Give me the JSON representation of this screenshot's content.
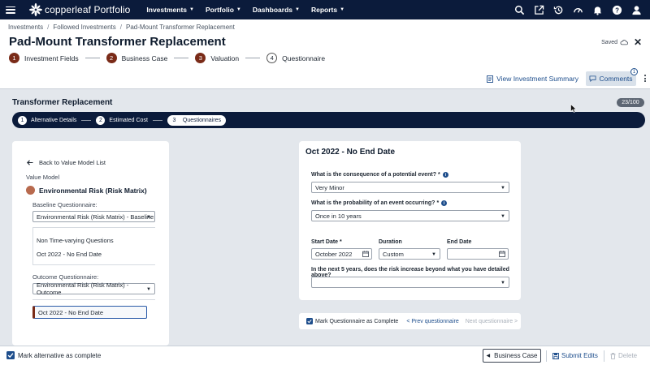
{
  "nav": {
    "logo_text": "copperleaf Portfolio",
    "menu": [
      {
        "label": "Investments"
      },
      {
        "label": "Portfolio"
      },
      {
        "label": "Dashboards"
      },
      {
        "label": "Reports"
      }
    ],
    "icons": [
      "search-icon",
      "external-link-icon",
      "history-icon",
      "performance-icon",
      "bell-icon",
      "help-icon",
      "user-icon"
    ]
  },
  "breadcrumb": [
    "Investments",
    "Followed Investments",
    "Pad-Mount Transformer Replacement"
  ],
  "page_title": "Pad-Mount Transformer Replacement",
  "saved_label": "Saved",
  "steps": [
    {
      "num": "1",
      "label": "Investment Fields"
    },
    {
      "num": "2",
      "label": "Business Case"
    },
    {
      "num": "3",
      "label": "Valuation"
    },
    {
      "num": "4",
      "label": "Questionnaire"
    }
  ],
  "view_summary_label": "View Investment Summary",
  "comments": {
    "label": "Comments",
    "count": "1"
  },
  "section": {
    "title": "Transformer Replacement",
    "counter": "23/100"
  },
  "substeps": [
    {
      "num": "1",
      "label": "Alternative Details"
    },
    {
      "num": "2",
      "label": "Estimated Cost"
    },
    {
      "num": "3",
      "label": "Questionnaires"
    }
  ],
  "left_panel": {
    "back_label": "Back to Value Model List",
    "value_model_label": "Value Model",
    "value_model_name": "Environmental Risk (Risk Matrix)",
    "baseline_label": "Baseline Questionnaire:",
    "baseline_value": "Environmental Risk (Risk Matrix) - Baseline",
    "baseline_items": [
      "Non Time-varying Questions",
      "Oct 2022 - No End Date"
    ],
    "outcome_label": "Outcome Questionnaire:",
    "outcome_value": "Environmental Risk (Risk Matrix) - Outcome",
    "outcome_selected": "Oct 2022 - No End Date"
  },
  "right_panel": {
    "title": "Oct 2022 - No End Date",
    "q1_label": "What is the consequence of a potential event?",
    "q1_value": "Very Minor",
    "q2_label": "What is the probability of an event occurring?",
    "q2_value": "Once in 10 years",
    "required_mark": "*",
    "start_date_label": "Start Date",
    "start_date_value": "October 2022",
    "duration_label": "Duration",
    "duration_value": "Custom",
    "end_date_label": "End Date",
    "end_date_value": "",
    "q3_label": "In the next 5 years, does the risk increase beyond what you have detailed above?",
    "q3_value": ""
  },
  "rp_footer": {
    "mark_complete": "Mark Questionnaire as Complete",
    "prev": "< Prev questionnaire",
    "next": "Next questionnaire >"
  },
  "bottom": {
    "mark_alt": "Mark alternative as complete",
    "business_case": "Business Case",
    "submit_edits": "Submit Edits",
    "delete": "Delete"
  },
  "colors": {
    "nav_bg": "#0b1b3b",
    "step_active": "#7a2b18",
    "link_blue": "#1e4e8c"
  }
}
